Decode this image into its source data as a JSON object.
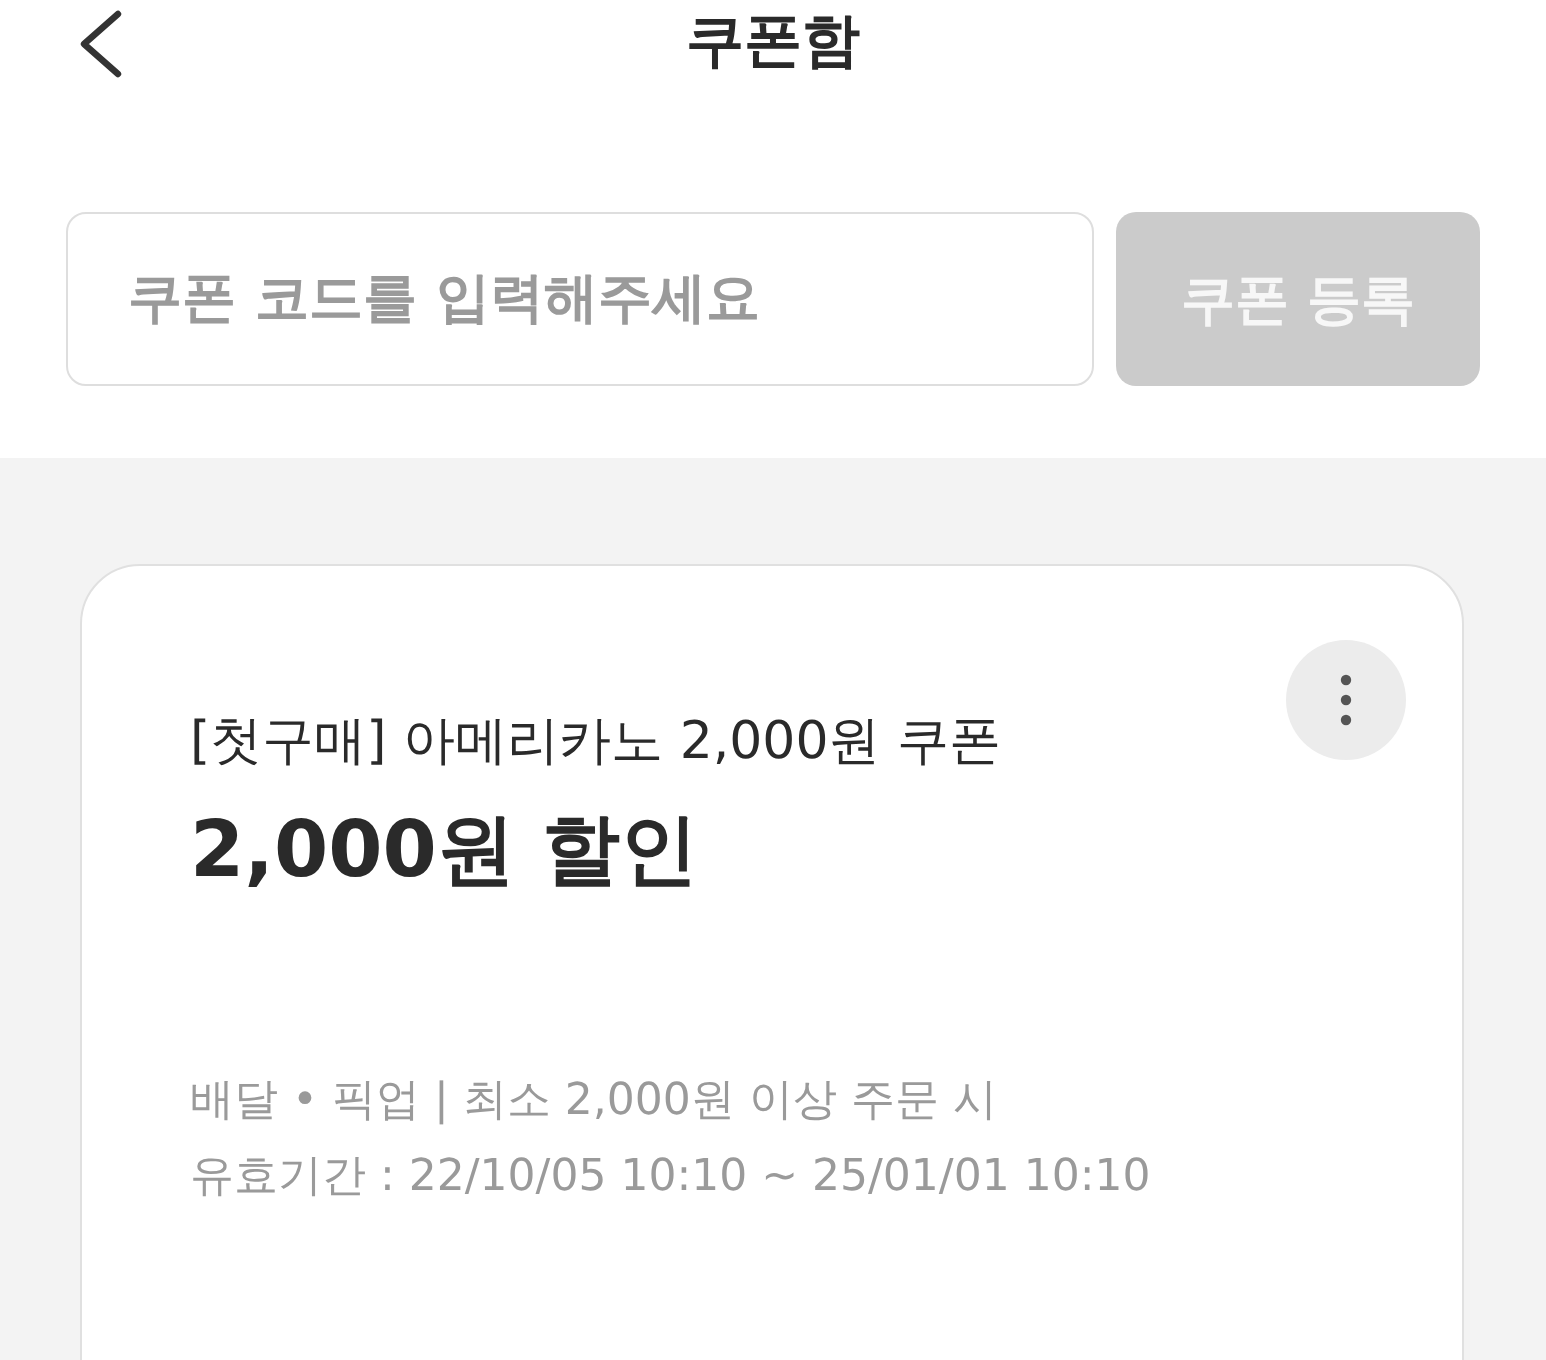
{
  "header": {
    "title": "쿠폰함"
  },
  "coupon_form": {
    "placeholder": "쿠폰 코드를 입력해주세요",
    "button": {
      "label": "쿠폰 등록",
      "disabled": true
    }
  },
  "coupons": [
    {
      "name": "[첫구매] 아메리카노 2,000원 쿠폰",
      "discount": "2,000원 할인",
      "conditions": "배달 • 픽업 | 최소 2,000원 이상 주문 시",
      "validity": "유효기간 : 22/10/05 10:10 ~ 25/01/01 10:10"
    }
  ]
}
